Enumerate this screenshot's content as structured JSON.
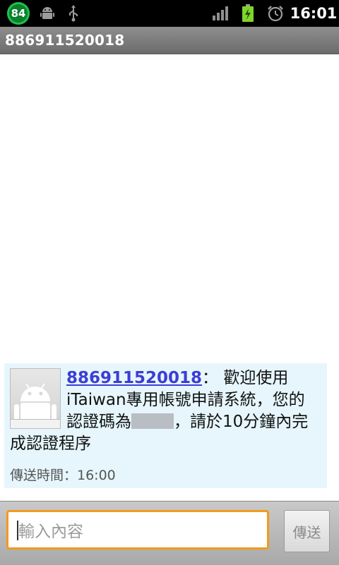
{
  "status_bar": {
    "notification_count": "84",
    "time": "16:01",
    "icons": [
      "android-icon",
      "usb-icon",
      "signal-icon",
      "battery-charging-icon",
      "alarm-icon"
    ]
  },
  "header": {
    "title": "886911520018"
  },
  "message": {
    "sender": "886911520018",
    "separator": "：",
    "text_part1": " 歡迎使用iTaiwan專用帳號申請系統，您的認證碼為",
    "text_part2": "，請於10分鐘內完成認證程序",
    "timestamp": "傳送時間：16:00"
  },
  "composer": {
    "placeholder": "輸入內容",
    "send_label": "傳送"
  },
  "colors": {
    "accent_input_border": "#f39a1d",
    "message_bg": "#e6f6fc",
    "sender_link": "#3d3dd6"
  }
}
